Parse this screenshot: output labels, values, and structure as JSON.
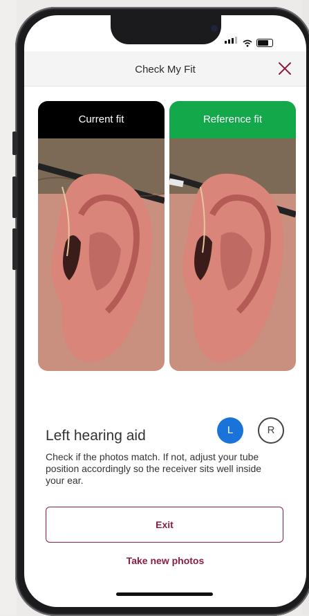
{
  "header": {
    "title": "Check My Fit"
  },
  "photos": {
    "current_label": "Current fit",
    "reference_label": "Reference fit"
  },
  "aid": {
    "title": "Left hearing aid",
    "left_button": "L",
    "right_button": "R",
    "selected": "L",
    "instructions": "Check if the photos match. If not, adjust  your tube position accordingly so the receiver sits well inside your ear."
  },
  "actions": {
    "exit_label": "Exit",
    "take_photos_label": "Take new photos"
  },
  "colors": {
    "accent": "#8b1e3f",
    "selected_blue": "#1a73d9",
    "reference_green": "#13a84a",
    "current_black": "#000000"
  },
  "icons": {
    "close": "close-icon",
    "signal": "signal-icon",
    "wifi": "wifi-icon",
    "battery": "battery-icon"
  }
}
